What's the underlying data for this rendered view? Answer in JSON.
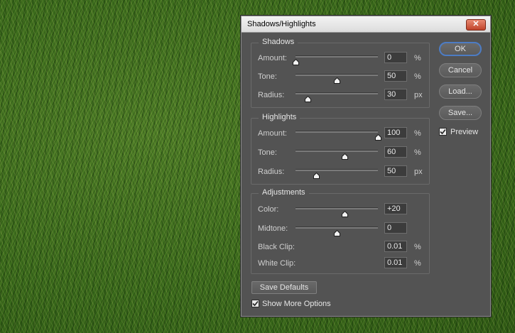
{
  "window": {
    "title": "Shadows/Highlights",
    "close_symbol": "✕"
  },
  "shadows": {
    "title": "Shadows",
    "amount": {
      "label": "Amount:",
      "value": "0",
      "unit": "%",
      "slider": 0.0
    },
    "tone": {
      "label": "Tone:",
      "value": "50",
      "unit": "%",
      "slider": 0.5
    },
    "radius": {
      "label": "Radius:",
      "value": "30",
      "unit": "px",
      "slider": 0.15
    }
  },
  "highlights": {
    "title": "Highlights",
    "amount": {
      "label": "Amount:",
      "value": "100",
      "unit": "%",
      "slider": 1.0
    },
    "tone": {
      "label": "Tone:",
      "value": "60",
      "unit": "%",
      "slider": 0.6
    },
    "radius": {
      "label": "Radius:",
      "value": "50",
      "unit": "px",
      "slider": 0.25
    }
  },
  "adjustments": {
    "title": "Adjustments",
    "color": {
      "label": "Color:",
      "value": "+20",
      "slider": 0.6
    },
    "midtone": {
      "label": "Midtone:",
      "value": "0",
      "slider": 0.5
    },
    "black_clip": {
      "label": "Black Clip:",
      "value": "0.01",
      "unit": "%"
    },
    "white_clip": {
      "label": "White Clip:",
      "value": "0.01",
      "unit": "%"
    }
  },
  "buttons": {
    "ok": "OK",
    "cancel": "Cancel",
    "load": "Load...",
    "save": "Save...",
    "save_defaults": "Save Defaults"
  },
  "options": {
    "preview": {
      "label": "Preview",
      "checked": true
    },
    "show_more": {
      "label": "Show More Options",
      "checked": true
    }
  },
  "colors": {
    "dialog_bg": "#535353",
    "accent": "#4d7cc4"
  }
}
